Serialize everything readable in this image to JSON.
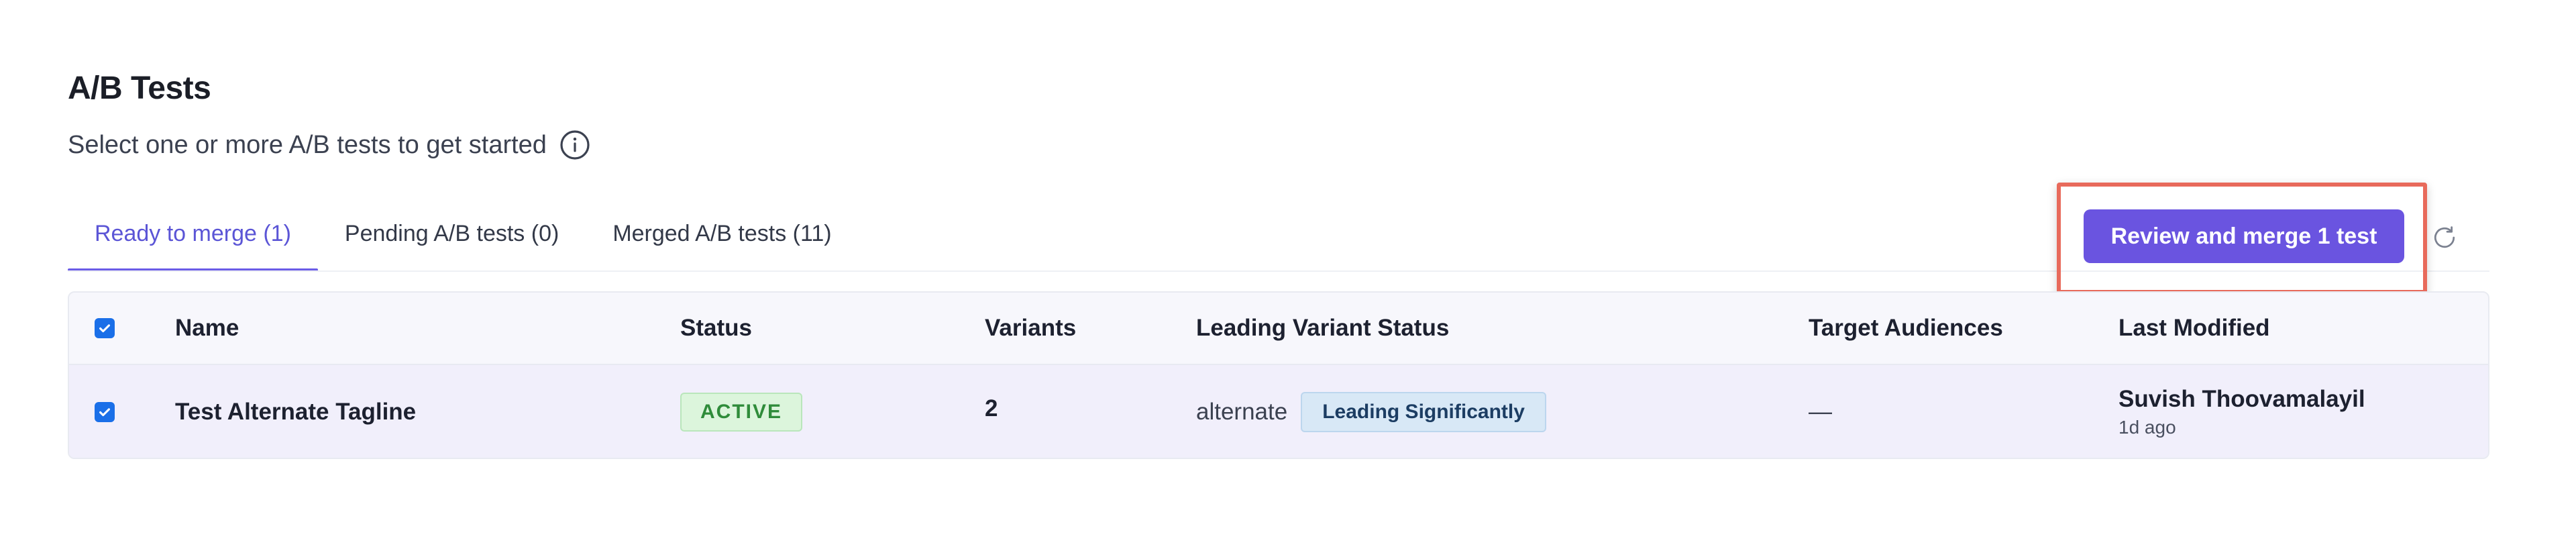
{
  "header": {
    "title": "A/B Tests",
    "subtitle": "Select one or more A/B tests to get started",
    "info_icon": "info-icon"
  },
  "tabs": [
    {
      "label": "Ready to merge (1)",
      "active": true
    },
    {
      "label": "Pending A/B tests (0)",
      "active": false
    },
    {
      "label": "Merged A/B tests (11)",
      "active": false
    }
  ],
  "actions": {
    "merge_button": "Review and merge 1 test",
    "refresh_icon": "refresh-icon",
    "accent_color": "#6a54e0",
    "highlight_color": "#e86a5b"
  },
  "table": {
    "columns": [
      "Name",
      "Status",
      "Variants",
      "Leading Variant Status",
      "Target Audiences",
      "Last Modified"
    ],
    "select_all_checked": true,
    "rows": [
      {
        "checked": true,
        "name": "Test Alternate Tagline",
        "status": "ACTIVE",
        "variants": "2",
        "leading_variant": "alternate",
        "leading_badge": "Leading Significantly",
        "target_audiences": "—",
        "modified_by": "Suvish Thoovamalayil",
        "modified_ago": "1d ago"
      }
    ]
  }
}
